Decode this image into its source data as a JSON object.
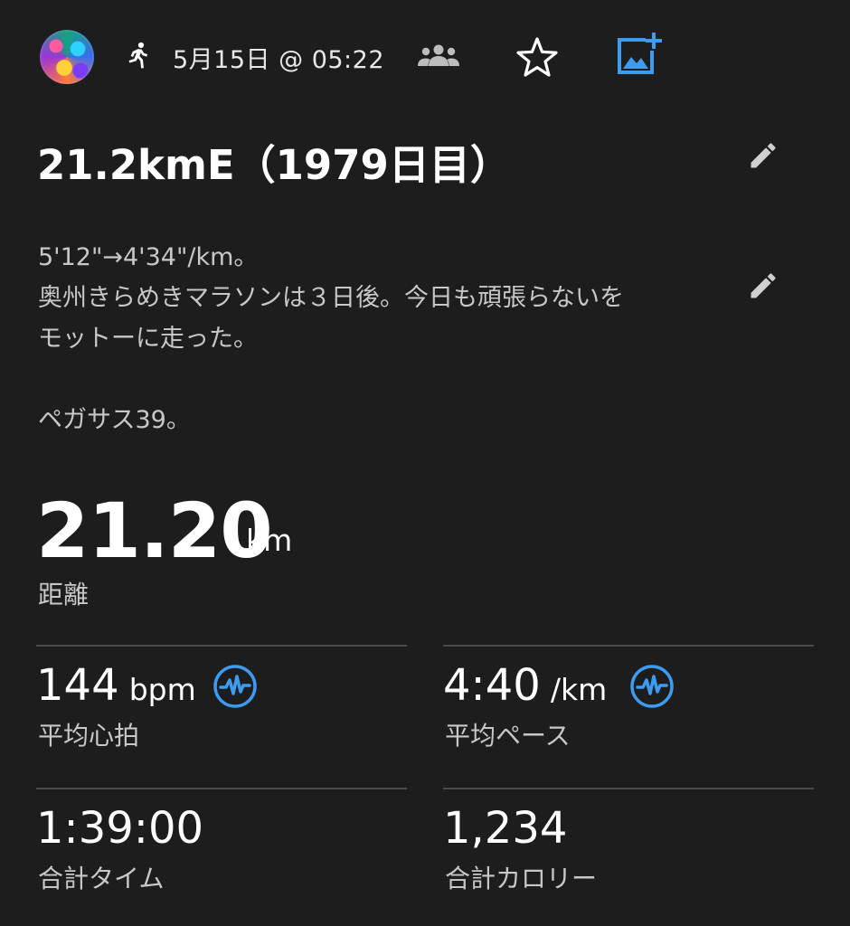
{
  "header": {
    "activity_icon": "running-person-icon",
    "date_time": "5月15日 @ 05:22",
    "group_icon": "people-group-icon",
    "favorite_icon": "star-outline-icon",
    "add_photo_icon": "add-photo-icon",
    "accent_color": "#3b9cf2"
  },
  "activity": {
    "title": "21.2kmE（1979日目）",
    "description_lines": [
      "5'12\"→4'34\"/km。",
      "奥州きらめきマラソンは３日後。今日も頑張らないを",
      "モットーに走った。",
      "",
      "ペガサス39。"
    ]
  },
  "distance": {
    "value": "21.20",
    "unit": "km",
    "label": "距離"
  },
  "stats": {
    "heart_rate": {
      "value": "144",
      "unit": "bpm",
      "label": "平均心拍",
      "icon": "heart-rate-icon"
    },
    "pace": {
      "value": "4:40",
      "unit": "/km",
      "label": "平均ペース",
      "icon": "heart-rate-icon"
    },
    "total_time": {
      "value": "1:39:00",
      "label": "合計タイム"
    },
    "calories": {
      "value": "1,234",
      "label": "合計カロリー"
    }
  }
}
